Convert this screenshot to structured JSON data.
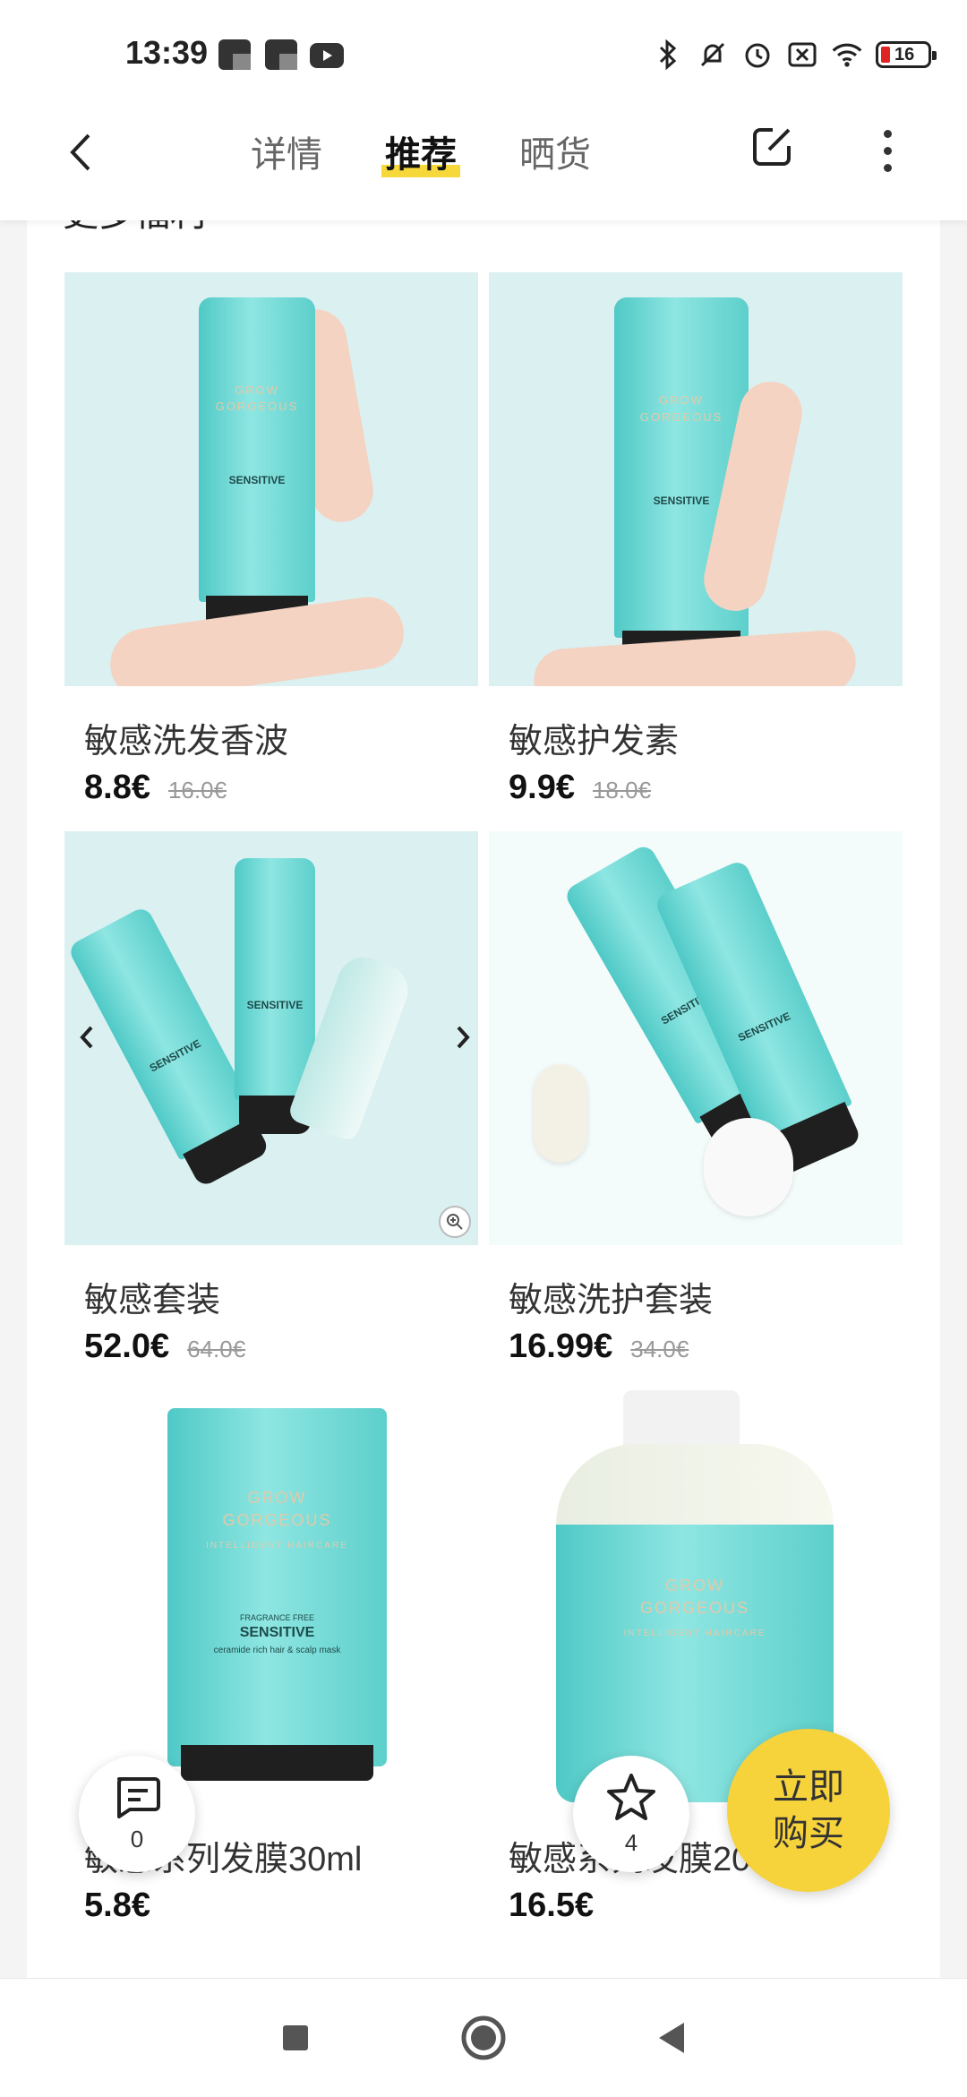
{
  "status_bar": {
    "time": "13:39",
    "battery_level": "16",
    "battery_color": "#e02424",
    "notification_icons": [
      "app-notification-icon",
      "app-notification-icon",
      "youtube-icon"
    ],
    "system_icons": [
      "bluetooth-icon",
      "mute-icon",
      "alarm-icon",
      "sim-off-icon",
      "wifi-icon",
      "battery-icon"
    ]
  },
  "header": {
    "tabs": [
      {
        "label": "详情",
        "active": false
      },
      {
        "label": "推荐",
        "active": true
      },
      {
        "label": "晒货",
        "active": false
      }
    ],
    "accent": "#f7d83a"
  },
  "section": {
    "cut_title": "更多福利"
  },
  "products": [
    {
      "name": "敏感洗发香波",
      "price": "8.8€",
      "original_price": "16.0€"
    },
    {
      "name": "敏感护发素",
      "price": "9.9€",
      "original_price": "18.0€"
    },
    {
      "name": "敏感套装",
      "price": "52.0€",
      "original_price": "64.0€"
    },
    {
      "name": "敏感洗护套装",
      "price": "16.99€",
      "original_price": "34.0€"
    },
    {
      "name": "敏感系列发膜30ml",
      "price": "5.8€",
      "original_price": ""
    },
    {
      "name": "敏感系列发膜200ml",
      "price": "16.5€",
      "original_price": ""
    }
  ],
  "product_labels": {
    "brand_line1": "GROW",
    "brand_line2": "GORGEOUS",
    "brand_line3": "INTELLIGENT HAIRCARE",
    "variant": "SENSITIVE",
    "fragrance_free": "FRAGRANCE FREE",
    "mask_desc": "ceramide rich hair & scalp mask"
  },
  "floating": {
    "comment_count": "0",
    "favorite_count": "4",
    "buy_label": "立即购买",
    "buy_color": "#f6d23b"
  }
}
